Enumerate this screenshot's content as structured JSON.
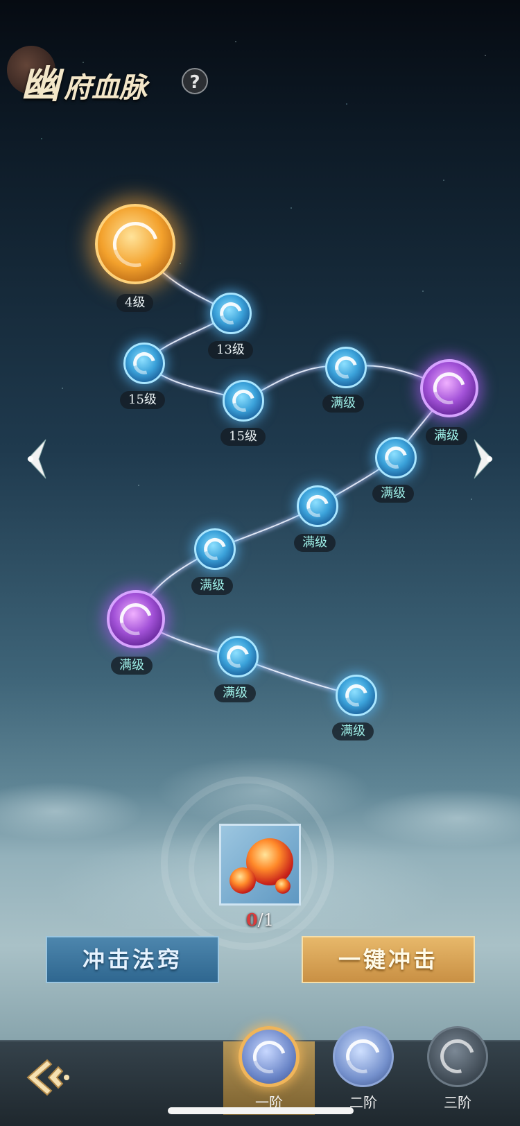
{
  "header": {
    "title_big": "幽",
    "title_rest": "府血脉",
    "help_label": "?"
  },
  "nodes": [
    {
      "id": "n1",
      "kind": "gold",
      "level": "4级"
    },
    {
      "id": "n2",
      "kind": "blue",
      "level": "13级"
    },
    {
      "id": "n3",
      "kind": "blue",
      "level": "15级"
    },
    {
      "id": "n4",
      "kind": "blue",
      "level": "15级"
    },
    {
      "id": "n5",
      "kind": "blue",
      "level": "满级"
    },
    {
      "id": "n6",
      "kind": "purple",
      "level": "满级"
    },
    {
      "id": "n7",
      "kind": "blue",
      "level": "满级"
    },
    {
      "id": "n8",
      "kind": "blue",
      "level": "满级"
    },
    {
      "id": "n9",
      "kind": "blue",
      "level": "满级"
    },
    {
      "id": "n10",
      "kind": "purple",
      "level": "满级"
    },
    {
      "id": "n11",
      "kind": "blue",
      "level": "满级"
    },
    {
      "id": "n12",
      "kind": "blue",
      "level": "满级"
    }
  ],
  "item": {
    "count_current": "0",
    "count_sep_total": "/1"
  },
  "buttons": {
    "breakthrough": "冲击法窍",
    "one_click": "一键冲击"
  },
  "tabs": [
    {
      "label": "一阶",
      "selected": true
    },
    {
      "label": "二阶",
      "selected": false
    },
    {
      "label": "三阶",
      "selected": false
    }
  ],
  "colors": {
    "gold": "#f3a12c",
    "blue": "#3ba2da",
    "purple": "#a352d8",
    "count_red": "#d93b3b"
  }
}
